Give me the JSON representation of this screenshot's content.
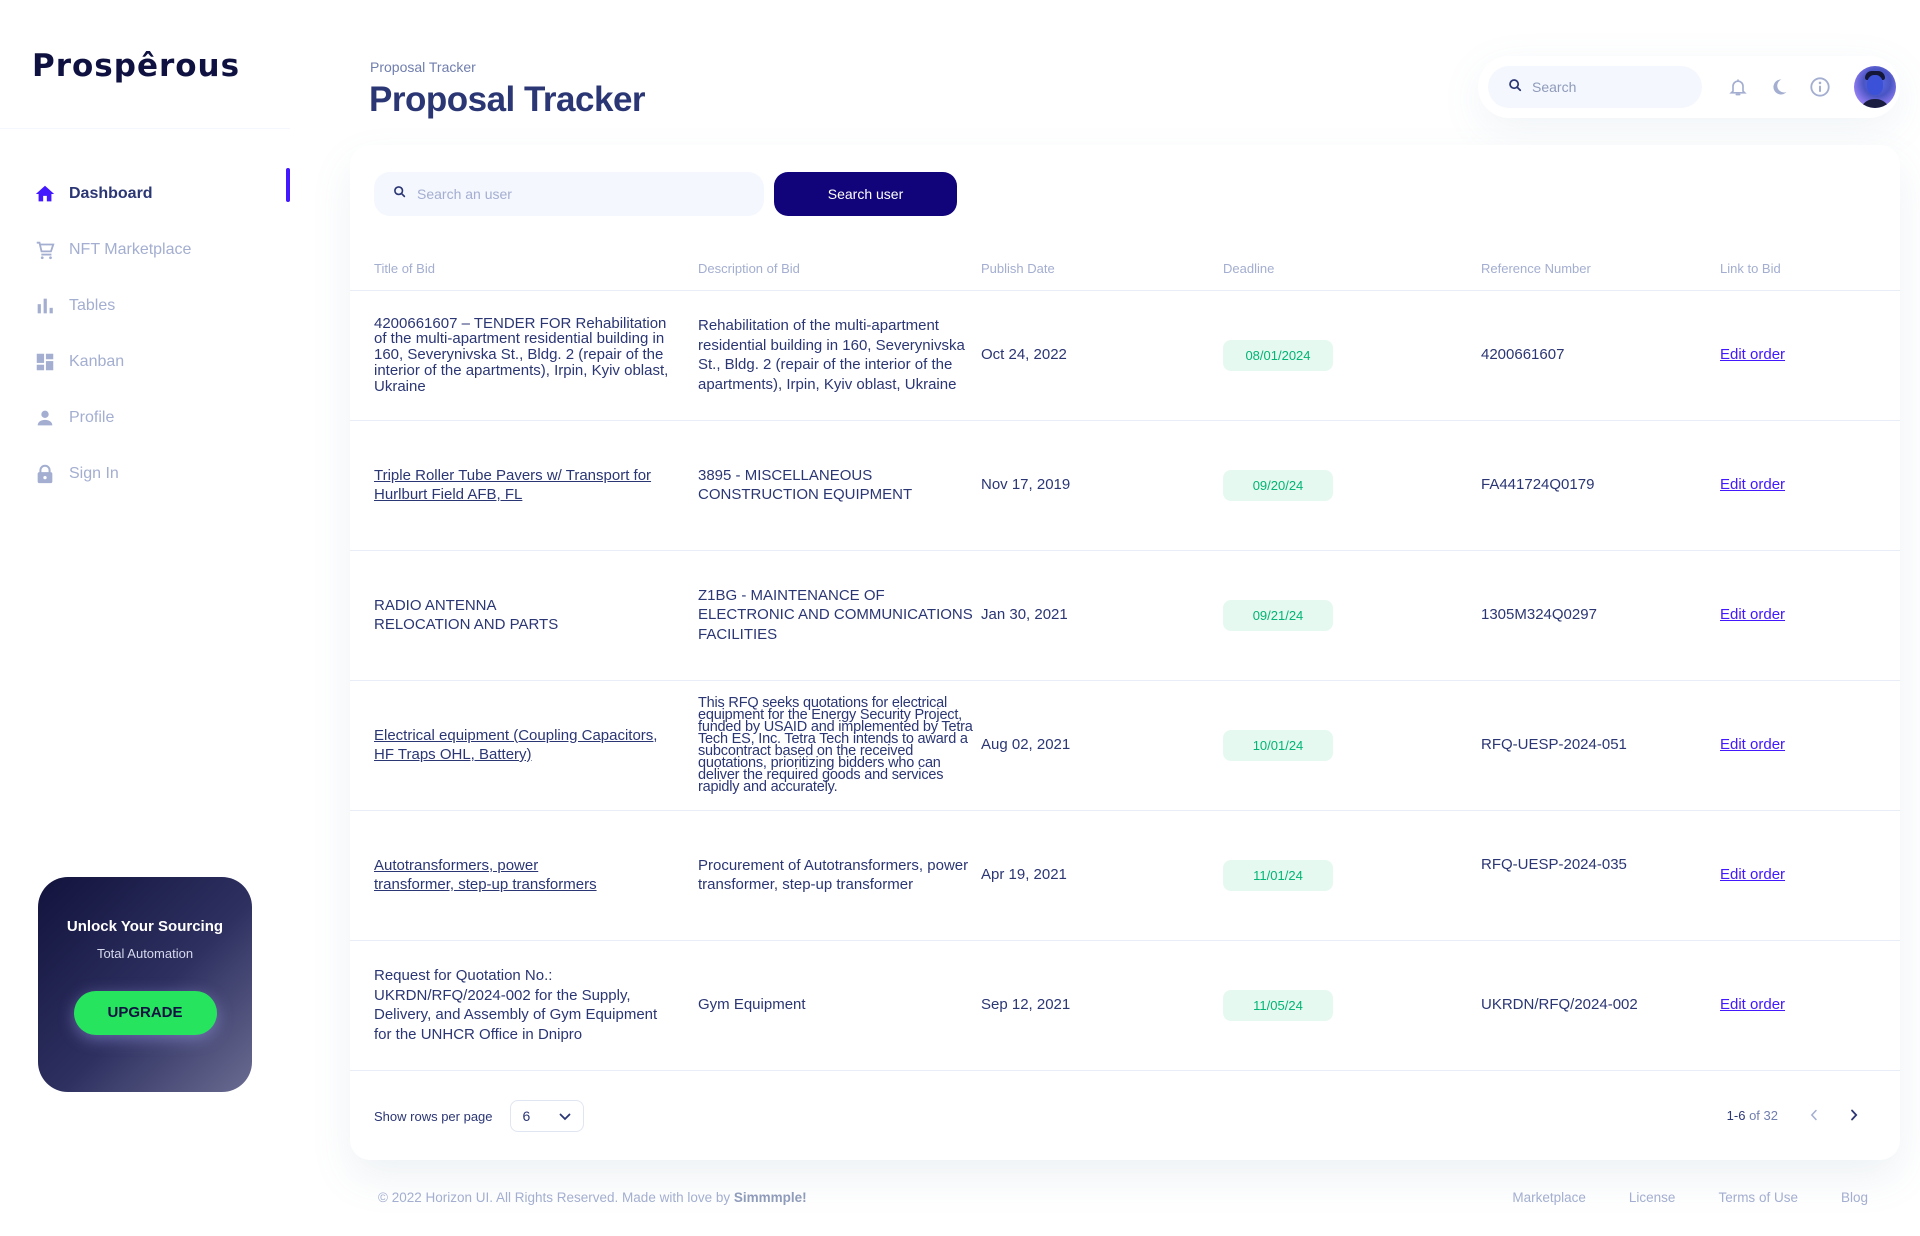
{
  "brand": {
    "name": "Prospêrous"
  },
  "sidebar": {
    "items": [
      {
        "label": "Dashboard",
        "icon": "home-icon",
        "active": true
      },
      {
        "label": "NFT Marketplace",
        "icon": "cart-icon",
        "active": false
      },
      {
        "label": "Tables",
        "icon": "bar-chart-icon",
        "active": false
      },
      {
        "label": "Kanban",
        "icon": "dashboard-grid-icon",
        "active": false
      },
      {
        "label": "Profile",
        "icon": "person-icon",
        "active": false
      },
      {
        "label": "Sign In",
        "icon": "lock-icon",
        "active": false
      }
    ],
    "promo": {
      "title": "Unlock Your Sourcing",
      "subtitle": "Total Automation",
      "button": "UPGRADE"
    }
  },
  "header": {
    "breadcrumb": "Proposal Tracker",
    "title": "Proposal Tracker",
    "search_placeholder": "Search",
    "icons": [
      "bell-icon",
      "moon-icon",
      "info-icon"
    ]
  },
  "toolbar": {
    "search_placeholder": "Search an user",
    "search_button": "Search user"
  },
  "table": {
    "columns": [
      "Title of Bid",
      "Description of Bid",
      "Publish Date",
      "Deadline",
      "Reference Number",
      "Link to Bid"
    ],
    "rows": [
      {
        "title": "4200661607 – TENDER FOR Rehabilitation of the multi-apartment residential building in 160, Severynivska St., Bldg. 2 (repair of the interior of the apartments), Irpin, Kyiv oblast, Ukraine",
        "title_is_link": false,
        "description": "Rehabilitation of the multi-apartment residential building in 160, Severynivska St., Bldg. 2 (repair of the interior of the apartments), Irpin, Kyiv oblast, Ukraine",
        "publish_date": "Oct 24, 2022",
        "deadline": "08/01/2024",
        "reference": "4200661607",
        "link": "Edit order"
      },
      {
        "title": "Triple Roller Tube Pavers w/ Transport for Hurlburt Field AFB, FL",
        "title_is_link": true,
        "description": "3895 - MISCELLANEOUS CONSTRUCTION EQUIPMENT",
        "publish_date": "Nov 17, 2019",
        "deadline": "09/20/24",
        "reference": "FA441724Q0179",
        "link": "Edit order"
      },
      {
        "title": "RADIO ANTENNA RELOCATION AND PARTS",
        "title_is_link": false,
        "description": "Z1BG - MAINTENANCE OF ELECTRONIC AND COMMUNICATIONS FACILITIES",
        "publish_date": "Jan 30, 2021",
        "deadline": "09/21/24",
        "reference": "1305M324Q0297",
        "link": "Edit order"
      },
      {
        "title": "Electrical equipment (Coupling Capacitors, HF Traps OHL, Battery)",
        "title_is_link": true,
        "description": "This RFQ seeks quotations for electrical equipment for the Energy Security Project, funded by USAID and implemented by Tetra Tech ES, Inc. Tetra Tech intends to award a subcontract based on the received quotations, prioritizing bidders who can deliver the required goods and services rapidly and accurately.",
        "publish_date": "Aug 02, 2021",
        "deadline": "10/01/24",
        "reference": "RFQ-UESP-2024-051",
        "link": "Edit order"
      },
      {
        "title": "Autotransformers, power transformer, step-up transformers",
        "title_is_link": true,
        "description": "Procurement of Autotransformers, power transformer, step-up transformer",
        "publish_date": "Apr 19, 2021",
        "deadline": "11/01/24",
        "reference": "RFQ-UESP-2024-035",
        "link": "Edit order"
      },
      {
        "title": "Request for Quotation No.: UKRDN/RFQ/2024-002 for the Supply, Delivery, and Assembly of Gym Equipment for the UNHCR Office in Dnipro",
        "title_is_link": false,
        "description": "Gym Equipment",
        "publish_date": "Sep 12, 2021",
        "deadline": "11/05/24",
        "reference": "UKRDN/RFQ/2024-002",
        "link": "Edit order"
      }
    ]
  },
  "pagination": {
    "rows_label": "Show rows per page",
    "rows_value": "6",
    "range": "1-6",
    "of_label": "of 32"
  },
  "footer": {
    "copyright": "© 2022 Horizon UI. All Rights Reserved. Made with love by",
    "author": "Simmmple!",
    "links": [
      "Marketplace",
      "License",
      "Terms of Use",
      "Blog"
    ]
  },
  "colors": {
    "primary_text": "#2b3674",
    "muted_text": "#a3aed0",
    "accent": "#4318ff",
    "button_dark": "#11047a",
    "badge_bg": "#e6f9f1",
    "badge_text": "#01b574",
    "upgrade_green": "#27e45f"
  }
}
